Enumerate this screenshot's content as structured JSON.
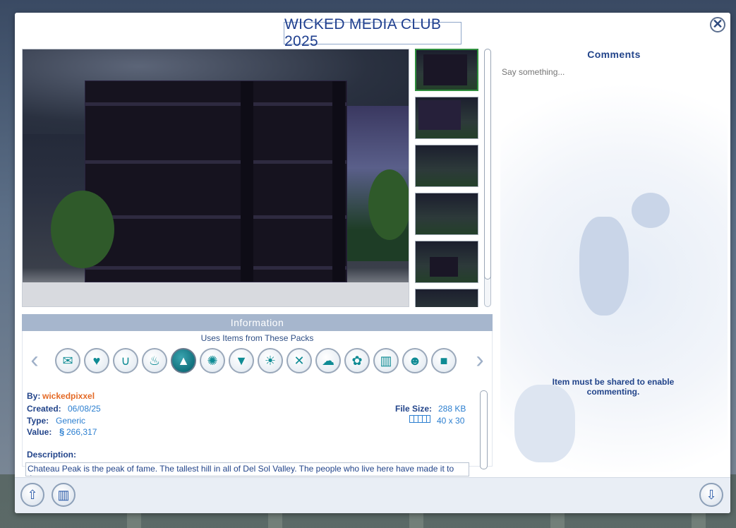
{
  "window": {
    "title": "WICKED MEDIA CLUB 2025",
    "close_glyph": "✕"
  },
  "gallery": {
    "thumbnail_count": 6,
    "selected_index": 0
  },
  "information": {
    "header": "Information",
    "packs_label": "Uses Items from These Packs",
    "packs": [
      {
        "icon": "money-envelope-icon",
        "glyph": "✉"
      },
      {
        "icon": "fire-heart-icon",
        "glyph": "♥"
      },
      {
        "icon": "horseshoe-icon",
        "glyph": "∪"
      },
      {
        "icon": "cake-icon",
        "glyph": "♨"
      },
      {
        "icon": "snowy-mountain-icon",
        "glyph": "▲"
      },
      {
        "icon": "lightbulb-icon",
        "glyph": "✺"
      },
      {
        "icon": "graduation-cap-icon",
        "glyph": "▼"
      },
      {
        "icon": "palm-island-icon",
        "glyph": "☀"
      },
      {
        "icon": "directors-chair-icon",
        "glyph": "✕"
      },
      {
        "icon": "weather-cloud-icon",
        "glyph": "☁"
      },
      {
        "icon": "paw-icon",
        "glyph": "✿"
      },
      {
        "icon": "city-buildings-icon",
        "glyph": "▥"
      },
      {
        "icon": "people-group-icon",
        "glyph": "☻"
      },
      {
        "icon": "briefcase-icon",
        "glyph": "■"
      }
    ],
    "selected_pack_index": 4,
    "by_label": "By:",
    "author": "wickedpixxel",
    "created_label": "Created:",
    "created_value": "06/08/25",
    "type_label": "Type:",
    "type_value": "Generic",
    "value_label": "Value:",
    "value_currency": "§",
    "value_amount": "266,317",
    "file_size_label": "File Size:",
    "file_size_value": "288 KB",
    "lot_size_value": "40 x 30",
    "description_label": "Description:",
    "description_text": "Chateau Peak is the peak of fame. The tallest hill in all of Del Sol Valley. The people who live here have made it to the top."
  },
  "comments": {
    "title": "Comments",
    "placeholder": "Say something...",
    "note": "Item must be shared to enable commenting."
  },
  "footer": {
    "upload_icon": "cloud-upload-icon",
    "delete_icon": "trash-icon",
    "download_icon": "download-icon"
  }
}
